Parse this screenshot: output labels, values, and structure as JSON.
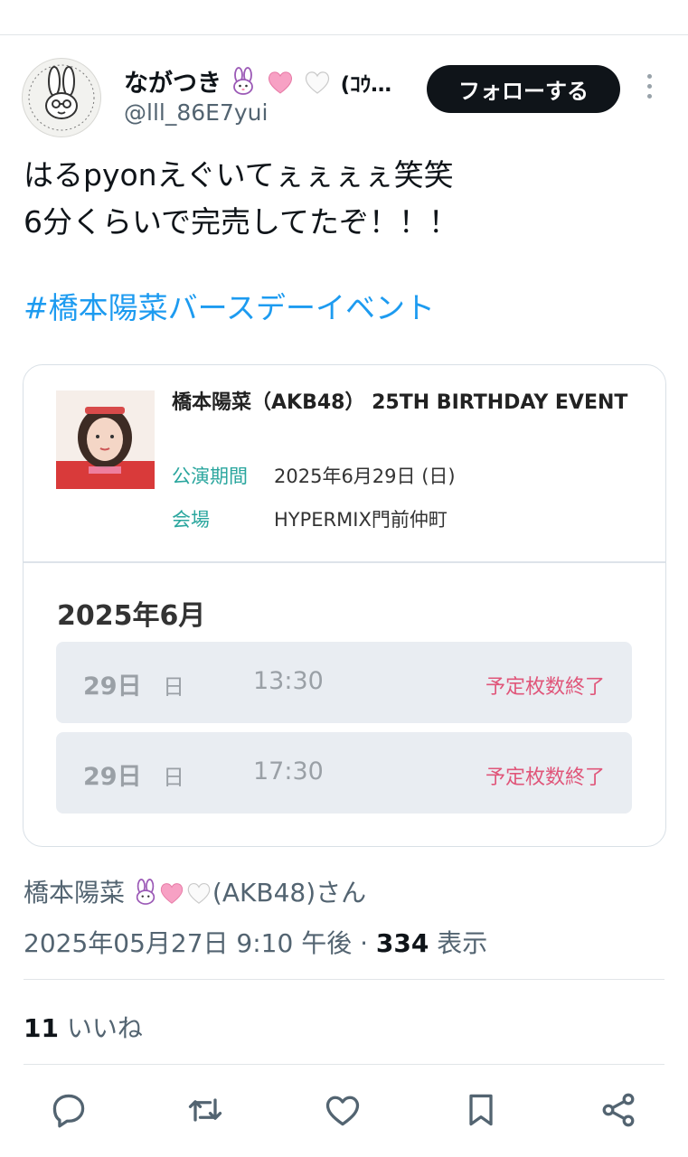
{
  "header": {
    "display_name": "ながつき",
    "name_suffix": "(ｺｳ…",
    "handle": "@lll_86E7yui",
    "follow_label": "フォローする"
  },
  "tweet": {
    "line1": "はるpyonえぐいてぇぇぇぇ笑笑",
    "line2": "6分くらいで完売してたぞ！！！",
    "hashtag": "#橋本陽菜バースデーイベント"
  },
  "card": {
    "title": "橋本陽菜（AKB48） 25TH BIRTHDAY EVENT",
    "period_label": "公演期間",
    "period_value": "2025年6月29日 (日)",
    "venue_label": "会場",
    "venue_value": "HYPERMIX門前仲町",
    "month": "2025年6月",
    "slots": [
      {
        "day": "29日",
        "weekday": "日",
        "time": "13:30",
        "status": "予定枚数終了"
      },
      {
        "day": "29日",
        "weekday": "日",
        "time": "17:30",
        "status": "予定枚数終了"
      }
    ]
  },
  "via": {
    "name": "橋本陽菜",
    "suffix": "(AKB48)さん"
  },
  "meta": {
    "timestamp": "2025年05月27日 9:10 午後",
    "separator": "·",
    "views": "334",
    "views_label": "表示"
  },
  "engagement": {
    "likes": "11",
    "likes_label": "いいね"
  },
  "actions": [
    "reply-icon",
    "retweet-icon",
    "like-icon",
    "bookmark-icon",
    "share-icon"
  ],
  "colors": {
    "accent": "#1d9bf0",
    "teal_label": "#2aa69e",
    "sold_out": "#e0567a",
    "follow_bg": "#0f1419"
  }
}
